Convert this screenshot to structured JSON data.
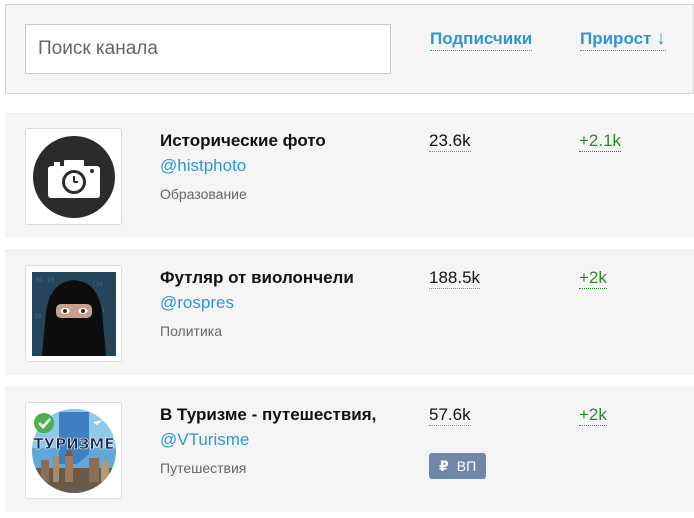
{
  "search": {
    "placeholder": "Поиск канала",
    "value": ""
  },
  "columns": {
    "subscribers_label": "Подписчики",
    "growth_label": "Прирост",
    "sort_arrow": "↓"
  },
  "channels": [
    {
      "name": "Исторические фото",
      "handle": "@histphoto",
      "category": "Образование",
      "subscribers": "23.6k",
      "growth": "+2.1k",
      "avatar_icon": "camera-clock-icon"
    },
    {
      "name": "Футляр от виолончели",
      "handle": "@rospres",
      "category": "Политика",
      "subscribers": "188.5k",
      "growth": "+2k",
      "avatar_icon": "masked-person-photo"
    },
    {
      "name": "В Туризме - путешествия,",
      "handle": "@VTurisme",
      "category": "Путешествия",
      "subscribers": "57.6k",
      "growth": "+2k",
      "avatar_icon": "tourism-logo",
      "avatar_text": "ТУРИЗМЕ",
      "badge": {
        "icon": "ruble-icon",
        "symbol": "₽",
        "label": "ВП"
      }
    }
  ],
  "colors": {
    "link": "#2f96d6",
    "growth": "#2a8a2a",
    "badge": "#6f88a9",
    "row_bg": "#f5f5f5"
  }
}
